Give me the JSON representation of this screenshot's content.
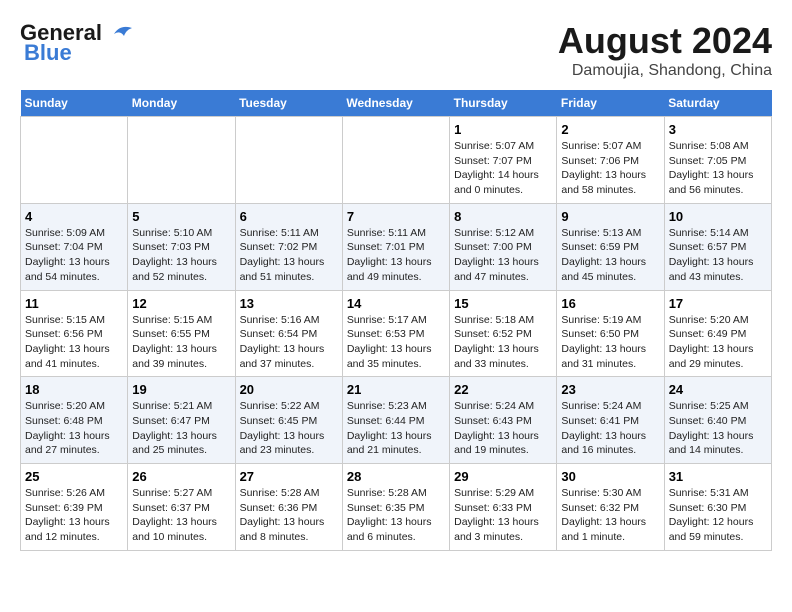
{
  "logo": {
    "line1": "General",
    "line2": "Blue"
  },
  "title": "August 2024",
  "subtitle": "Damoujia, Shandong, China",
  "days_of_week": [
    "Sunday",
    "Monday",
    "Tuesday",
    "Wednesday",
    "Thursday",
    "Friday",
    "Saturday"
  ],
  "weeks": [
    [
      {
        "day": "",
        "info": ""
      },
      {
        "day": "",
        "info": ""
      },
      {
        "day": "",
        "info": ""
      },
      {
        "day": "",
        "info": ""
      },
      {
        "day": "1",
        "info": "Sunrise: 5:07 AM\nSunset: 7:07 PM\nDaylight: 14 hours\nand 0 minutes."
      },
      {
        "day": "2",
        "info": "Sunrise: 5:07 AM\nSunset: 7:06 PM\nDaylight: 13 hours\nand 58 minutes."
      },
      {
        "day": "3",
        "info": "Sunrise: 5:08 AM\nSunset: 7:05 PM\nDaylight: 13 hours\nand 56 minutes."
      }
    ],
    [
      {
        "day": "4",
        "info": "Sunrise: 5:09 AM\nSunset: 7:04 PM\nDaylight: 13 hours\nand 54 minutes."
      },
      {
        "day": "5",
        "info": "Sunrise: 5:10 AM\nSunset: 7:03 PM\nDaylight: 13 hours\nand 52 minutes."
      },
      {
        "day": "6",
        "info": "Sunrise: 5:11 AM\nSunset: 7:02 PM\nDaylight: 13 hours\nand 51 minutes."
      },
      {
        "day": "7",
        "info": "Sunrise: 5:11 AM\nSunset: 7:01 PM\nDaylight: 13 hours\nand 49 minutes."
      },
      {
        "day": "8",
        "info": "Sunrise: 5:12 AM\nSunset: 7:00 PM\nDaylight: 13 hours\nand 47 minutes."
      },
      {
        "day": "9",
        "info": "Sunrise: 5:13 AM\nSunset: 6:59 PM\nDaylight: 13 hours\nand 45 minutes."
      },
      {
        "day": "10",
        "info": "Sunrise: 5:14 AM\nSunset: 6:57 PM\nDaylight: 13 hours\nand 43 minutes."
      }
    ],
    [
      {
        "day": "11",
        "info": "Sunrise: 5:15 AM\nSunset: 6:56 PM\nDaylight: 13 hours\nand 41 minutes."
      },
      {
        "day": "12",
        "info": "Sunrise: 5:15 AM\nSunset: 6:55 PM\nDaylight: 13 hours\nand 39 minutes."
      },
      {
        "day": "13",
        "info": "Sunrise: 5:16 AM\nSunset: 6:54 PM\nDaylight: 13 hours\nand 37 minutes."
      },
      {
        "day": "14",
        "info": "Sunrise: 5:17 AM\nSunset: 6:53 PM\nDaylight: 13 hours\nand 35 minutes."
      },
      {
        "day": "15",
        "info": "Sunrise: 5:18 AM\nSunset: 6:52 PM\nDaylight: 13 hours\nand 33 minutes."
      },
      {
        "day": "16",
        "info": "Sunrise: 5:19 AM\nSunset: 6:50 PM\nDaylight: 13 hours\nand 31 minutes."
      },
      {
        "day": "17",
        "info": "Sunrise: 5:20 AM\nSunset: 6:49 PM\nDaylight: 13 hours\nand 29 minutes."
      }
    ],
    [
      {
        "day": "18",
        "info": "Sunrise: 5:20 AM\nSunset: 6:48 PM\nDaylight: 13 hours\nand 27 minutes."
      },
      {
        "day": "19",
        "info": "Sunrise: 5:21 AM\nSunset: 6:47 PM\nDaylight: 13 hours\nand 25 minutes."
      },
      {
        "day": "20",
        "info": "Sunrise: 5:22 AM\nSunset: 6:45 PM\nDaylight: 13 hours\nand 23 minutes."
      },
      {
        "day": "21",
        "info": "Sunrise: 5:23 AM\nSunset: 6:44 PM\nDaylight: 13 hours\nand 21 minutes."
      },
      {
        "day": "22",
        "info": "Sunrise: 5:24 AM\nSunset: 6:43 PM\nDaylight: 13 hours\nand 19 minutes."
      },
      {
        "day": "23",
        "info": "Sunrise: 5:24 AM\nSunset: 6:41 PM\nDaylight: 13 hours\nand 16 minutes."
      },
      {
        "day": "24",
        "info": "Sunrise: 5:25 AM\nSunset: 6:40 PM\nDaylight: 13 hours\nand 14 minutes."
      }
    ],
    [
      {
        "day": "25",
        "info": "Sunrise: 5:26 AM\nSunset: 6:39 PM\nDaylight: 13 hours\nand 12 minutes."
      },
      {
        "day": "26",
        "info": "Sunrise: 5:27 AM\nSunset: 6:37 PM\nDaylight: 13 hours\nand 10 minutes."
      },
      {
        "day": "27",
        "info": "Sunrise: 5:28 AM\nSunset: 6:36 PM\nDaylight: 13 hours\nand 8 minutes."
      },
      {
        "day": "28",
        "info": "Sunrise: 5:28 AM\nSunset: 6:35 PM\nDaylight: 13 hours\nand 6 minutes."
      },
      {
        "day": "29",
        "info": "Sunrise: 5:29 AM\nSunset: 6:33 PM\nDaylight: 13 hours\nand 3 minutes."
      },
      {
        "day": "30",
        "info": "Sunrise: 5:30 AM\nSunset: 6:32 PM\nDaylight: 13 hours\nand 1 minute."
      },
      {
        "day": "31",
        "info": "Sunrise: 5:31 AM\nSunset: 6:30 PM\nDaylight: 12 hours\nand 59 minutes."
      }
    ]
  ]
}
